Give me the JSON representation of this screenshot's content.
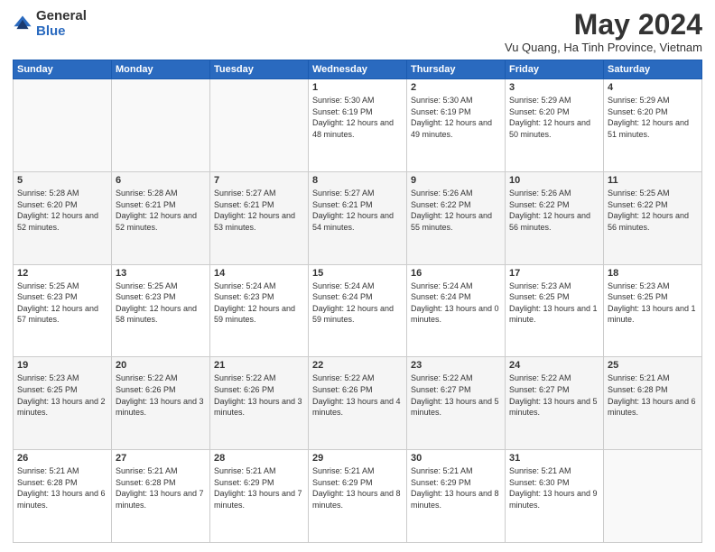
{
  "logo": {
    "general": "General",
    "blue": "Blue"
  },
  "title": "May 2024",
  "subtitle": "Vu Quang, Ha Tinh Province, Vietnam",
  "days_header": [
    "Sunday",
    "Monday",
    "Tuesday",
    "Wednesday",
    "Thursday",
    "Friday",
    "Saturday"
  ],
  "weeks": [
    [
      {
        "day": "",
        "sunrise": "",
        "sunset": "",
        "daylight": ""
      },
      {
        "day": "",
        "sunrise": "",
        "sunset": "",
        "daylight": ""
      },
      {
        "day": "",
        "sunrise": "",
        "sunset": "",
        "daylight": ""
      },
      {
        "day": "1",
        "sunrise": "Sunrise: 5:30 AM",
        "sunset": "Sunset: 6:19 PM",
        "daylight": "Daylight: 12 hours and 48 minutes."
      },
      {
        "day": "2",
        "sunrise": "Sunrise: 5:30 AM",
        "sunset": "Sunset: 6:19 PM",
        "daylight": "Daylight: 12 hours and 49 minutes."
      },
      {
        "day": "3",
        "sunrise": "Sunrise: 5:29 AM",
        "sunset": "Sunset: 6:20 PM",
        "daylight": "Daylight: 12 hours and 50 minutes."
      },
      {
        "day": "4",
        "sunrise": "Sunrise: 5:29 AM",
        "sunset": "Sunset: 6:20 PM",
        "daylight": "Daylight: 12 hours and 51 minutes."
      }
    ],
    [
      {
        "day": "5",
        "sunrise": "Sunrise: 5:28 AM",
        "sunset": "Sunset: 6:20 PM",
        "daylight": "Daylight: 12 hours and 52 minutes."
      },
      {
        "day": "6",
        "sunrise": "Sunrise: 5:28 AM",
        "sunset": "Sunset: 6:21 PM",
        "daylight": "Daylight: 12 hours and 52 minutes."
      },
      {
        "day": "7",
        "sunrise": "Sunrise: 5:27 AM",
        "sunset": "Sunset: 6:21 PM",
        "daylight": "Daylight: 12 hours and 53 minutes."
      },
      {
        "day": "8",
        "sunrise": "Sunrise: 5:27 AM",
        "sunset": "Sunset: 6:21 PM",
        "daylight": "Daylight: 12 hours and 54 minutes."
      },
      {
        "day": "9",
        "sunrise": "Sunrise: 5:26 AM",
        "sunset": "Sunset: 6:22 PM",
        "daylight": "Daylight: 12 hours and 55 minutes."
      },
      {
        "day": "10",
        "sunrise": "Sunrise: 5:26 AM",
        "sunset": "Sunset: 6:22 PM",
        "daylight": "Daylight: 12 hours and 56 minutes."
      },
      {
        "day": "11",
        "sunrise": "Sunrise: 5:25 AM",
        "sunset": "Sunset: 6:22 PM",
        "daylight": "Daylight: 12 hours and 56 minutes."
      }
    ],
    [
      {
        "day": "12",
        "sunrise": "Sunrise: 5:25 AM",
        "sunset": "Sunset: 6:23 PM",
        "daylight": "Daylight: 12 hours and 57 minutes."
      },
      {
        "day": "13",
        "sunrise": "Sunrise: 5:25 AM",
        "sunset": "Sunset: 6:23 PM",
        "daylight": "Daylight: 12 hours and 58 minutes."
      },
      {
        "day": "14",
        "sunrise": "Sunrise: 5:24 AM",
        "sunset": "Sunset: 6:23 PM",
        "daylight": "Daylight: 12 hours and 59 minutes."
      },
      {
        "day": "15",
        "sunrise": "Sunrise: 5:24 AM",
        "sunset": "Sunset: 6:24 PM",
        "daylight": "Daylight: 12 hours and 59 minutes."
      },
      {
        "day": "16",
        "sunrise": "Sunrise: 5:24 AM",
        "sunset": "Sunset: 6:24 PM",
        "daylight": "Daylight: 13 hours and 0 minutes."
      },
      {
        "day": "17",
        "sunrise": "Sunrise: 5:23 AM",
        "sunset": "Sunset: 6:25 PM",
        "daylight": "Daylight: 13 hours and 1 minute."
      },
      {
        "day": "18",
        "sunrise": "Sunrise: 5:23 AM",
        "sunset": "Sunset: 6:25 PM",
        "daylight": "Daylight: 13 hours and 1 minute."
      }
    ],
    [
      {
        "day": "19",
        "sunrise": "Sunrise: 5:23 AM",
        "sunset": "Sunset: 6:25 PM",
        "daylight": "Daylight: 13 hours and 2 minutes."
      },
      {
        "day": "20",
        "sunrise": "Sunrise: 5:22 AM",
        "sunset": "Sunset: 6:26 PM",
        "daylight": "Daylight: 13 hours and 3 minutes."
      },
      {
        "day": "21",
        "sunrise": "Sunrise: 5:22 AM",
        "sunset": "Sunset: 6:26 PM",
        "daylight": "Daylight: 13 hours and 3 minutes."
      },
      {
        "day": "22",
        "sunrise": "Sunrise: 5:22 AM",
        "sunset": "Sunset: 6:26 PM",
        "daylight": "Daylight: 13 hours and 4 minutes."
      },
      {
        "day": "23",
        "sunrise": "Sunrise: 5:22 AM",
        "sunset": "Sunset: 6:27 PM",
        "daylight": "Daylight: 13 hours and 5 minutes."
      },
      {
        "day": "24",
        "sunrise": "Sunrise: 5:22 AM",
        "sunset": "Sunset: 6:27 PM",
        "daylight": "Daylight: 13 hours and 5 minutes."
      },
      {
        "day": "25",
        "sunrise": "Sunrise: 5:21 AM",
        "sunset": "Sunset: 6:28 PM",
        "daylight": "Daylight: 13 hours and 6 minutes."
      }
    ],
    [
      {
        "day": "26",
        "sunrise": "Sunrise: 5:21 AM",
        "sunset": "Sunset: 6:28 PM",
        "daylight": "Daylight: 13 hours and 6 minutes."
      },
      {
        "day": "27",
        "sunrise": "Sunrise: 5:21 AM",
        "sunset": "Sunset: 6:28 PM",
        "daylight": "Daylight: 13 hours and 7 minutes."
      },
      {
        "day": "28",
        "sunrise": "Sunrise: 5:21 AM",
        "sunset": "Sunset: 6:29 PM",
        "daylight": "Daylight: 13 hours and 7 minutes."
      },
      {
        "day": "29",
        "sunrise": "Sunrise: 5:21 AM",
        "sunset": "Sunset: 6:29 PM",
        "daylight": "Daylight: 13 hours and 8 minutes."
      },
      {
        "day": "30",
        "sunrise": "Sunrise: 5:21 AM",
        "sunset": "Sunset: 6:29 PM",
        "daylight": "Daylight: 13 hours and 8 minutes."
      },
      {
        "day": "31",
        "sunrise": "Sunrise: 5:21 AM",
        "sunset": "Sunset: 6:30 PM",
        "daylight": "Daylight: 13 hours and 9 minutes."
      },
      {
        "day": "",
        "sunrise": "",
        "sunset": "",
        "daylight": ""
      }
    ]
  ]
}
